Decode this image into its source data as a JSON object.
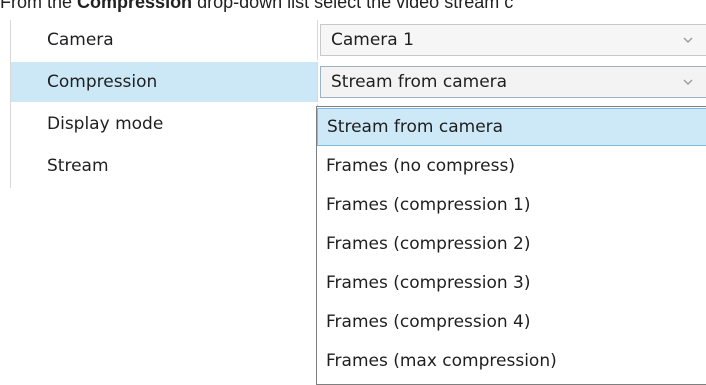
{
  "intro_text": {
    "before": "From the ",
    "bold": "Compression",
    "after": " drop-down list select the video stream c"
  },
  "properties": {
    "rows": [
      {
        "label": "Camera",
        "value": "Camera 1"
      },
      {
        "label": "Compression",
        "value": "Stream from camera"
      },
      {
        "label": "Display mode",
        "value": ""
      },
      {
        "label": "Stream",
        "value": ""
      }
    ],
    "selected_row": "Compression"
  },
  "dropdown": {
    "selected": "Stream from camera",
    "options": [
      "Stream from camera",
      "Frames (no compress)",
      "Frames (compression 1)",
      "Frames (compression 2)",
      "Frames (compression 3)",
      "Frames (compression 4)",
      "Frames (max compression)"
    ]
  },
  "icons": {
    "combo_arrow": "chevron-down-icon"
  },
  "colors": {
    "selected_row": "#cce8f7",
    "highlight_option": "#cde8f7",
    "highlight_border": "#7fb9dc",
    "grid_line": "#d8d8d8"
  }
}
